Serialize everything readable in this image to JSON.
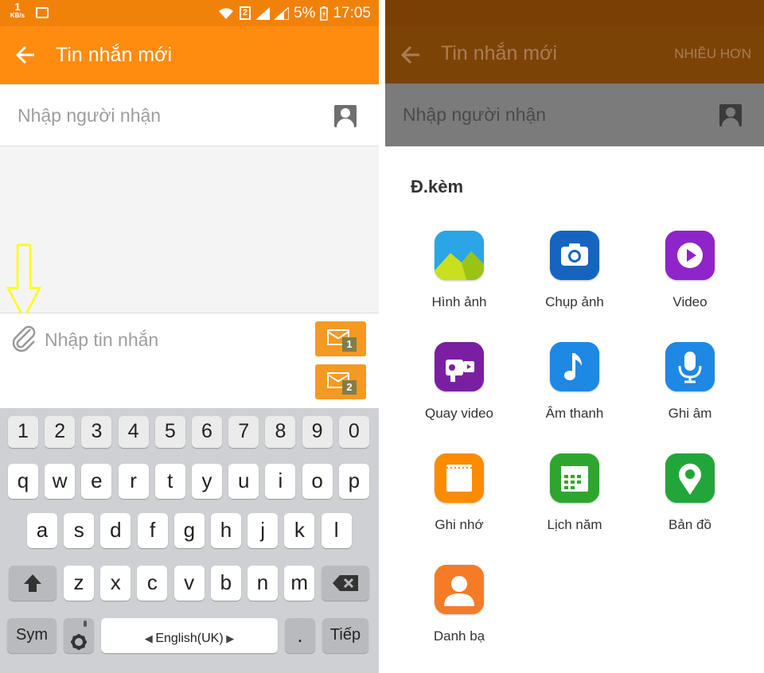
{
  "status_bar": {
    "speed_value": "1",
    "speed_unit": "KB/s",
    "sim_slot": "2",
    "battery": "5%",
    "time": "17:05"
  },
  "left_screen": {
    "app_title": "Tin nhắn mới",
    "recipient_placeholder": "Nhập người nhận",
    "message_placeholder": "Nhập tin nhắn",
    "send_sim1_label": "1",
    "send_sim2_label": "2",
    "keyboard": {
      "number_row": [
        "1",
        "2",
        "3",
        "4",
        "5",
        "6",
        "7",
        "8",
        "9",
        "0"
      ],
      "row1": [
        "q",
        "w",
        "e",
        "r",
        "t",
        "y",
        "u",
        "i",
        "o",
        "p"
      ],
      "row2": [
        "a",
        "s",
        "d",
        "f",
        "g",
        "h",
        "j",
        "k",
        "l"
      ],
      "row3": [
        "z",
        "x",
        "c",
        "v",
        "b",
        "n",
        "m"
      ],
      "sym_label": "Sym",
      "space_label": "English(UK)",
      "period_label": ".",
      "next_label": "Tiếp"
    }
  },
  "right_screen": {
    "app_title": "Tin nhắn mới",
    "more_label": "NHIỀU HƠN",
    "recipient_placeholder": "Nhập người nhận",
    "sheet_title": "Đ.kèm",
    "attachments": [
      {
        "label": "Hình ảnh",
        "icon": "gallery-icon",
        "color": "#29a6e6"
      },
      {
        "label": "Chụp ảnh",
        "icon": "camera-icon",
        "color": "#1565c0"
      },
      {
        "label": "Video",
        "icon": "video-play-icon",
        "color": "#8e24c9"
      },
      {
        "label": "Quay video",
        "icon": "video-recorder-icon",
        "color": "#7b1fa2"
      },
      {
        "label": "Âm thanh",
        "icon": "music-note-icon",
        "color": "#1e88e5"
      },
      {
        "label": "Ghi âm",
        "icon": "microphone-icon",
        "color": "#1e88e5"
      },
      {
        "label": "Ghi nhớ",
        "icon": "memo-icon",
        "color": "#fb8c00"
      },
      {
        "label": "Lịch năm",
        "icon": "calendar-icon",
        "color": "#2ea62e"
      },
      {
        "label": "Bản đồ",
        "icon": "map-pin-icon",
        "color": "#22a63a"
      },
      {
        "label": "Danh bạ",
        "icon": "contact-icon",
        "color": "#f57c26"
      }
    ]
  },
  "colors": {
    "accent": "#ff8c0f",
    "status_bar": "#f0820a",
    "annotation_arrow": "#ffff00"
  }
}
